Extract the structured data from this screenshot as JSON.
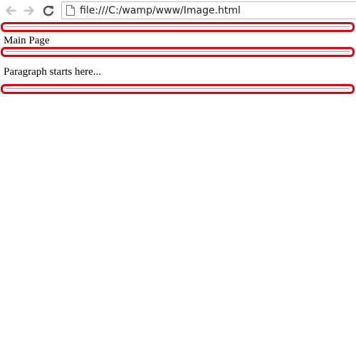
{
  "browser": {
    "url": "file:///C:/wamp/www/Image.html",
    "back_icon": "arrow-left-icon",
    "forward_icon": "arrow-right-icon",
    "reload_icon": "reload-icon",
    "page_icon": "document-icon"
  },
  "page": {
    "heading": "Main Page",
    "paragraph": "Paragraph starts here..."
  },
  "colors": {
    "highlight_border": "#e8000d",
    "nav_icon_disabled": "#c4c4c4",
    "nav_icon_enabled": "#5a5a5a"
  }
}
